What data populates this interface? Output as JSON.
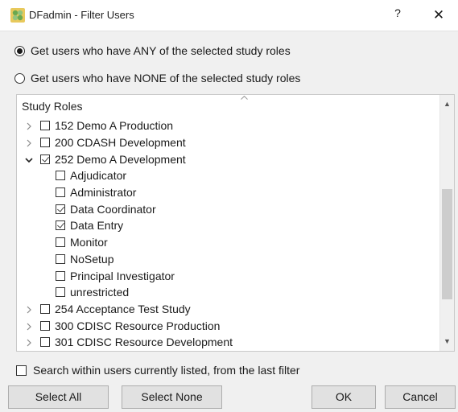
{
  "window": {
    "title": "DFadmin - Filter Users",
    "help_label": "?",
    "close_label": "✕"
  },
  "mode": {
    "any_label": "Get users who have ANY of the selected study roles",
    "none_label": "Get users who have NONE of the selected study roles",
    "selected": "any"
  },
  "tree": {
    "header": "Study Roles",
    "rows": [
      {
        "label": "152 Demo A Production",
        "level": 0,
        "expand": "collapsed",
        "checked": false
      },
      {
        "label": "200 CDASH Development",
        "level": 0,
        "expand": "collapsed",
        "checked": false
      },
      {
        "label": "252 Demo A Development",
        "level": 0,
        "expand": "expanded",
        "checked": true
      },
      {
        "label": "Adjudicator",
        "level": 1,
        "checked": false
      },
      {
        "label": "Administrator",
        "level": 1,
        "checked": false
      },
      {
        "label": "Data Coordinator",
        "level": 1,
        "checked": true
      },
      {
        "label": "Data Entry",
        "level": 1,
        "checked": true
      },
      {
        "label": "Monitor",
        "level": 1,
        "checked": false
      },
      {
        "label": "NoSetup",
        "level": 1,
        "checked": false
      },
      {
        "label": "Principal Investigator",
        "level": 1,
        "checked": false
      },
      {
        "label": "unrestricted",
        "level": 1,
        "checked": false
      },
      {
        "label": "254 Acceptance Test Study",
        "level": 0,
        "expand": "collapsed",
        "checked": false
      },
      {
        "label": "300 CDISC Resource Production",
        "level": 0,
        "expand": "collapsed",
        "checked": false
      },
      {
        "label": "301 CDISC Resource Development",
        "level": 0,
        "expand": "collapsed",
        "checked": false
      }
    ]
  },
  "filter": {
    "search_within_label": "Search within users currently listed, from the last filter",
    "checked": false
  },
  "buttons": {
    "select_all": "Select All",
    "select_none": "Select None",
    "ok": "OK",
    "cancel": "Cancel"
  }
}
